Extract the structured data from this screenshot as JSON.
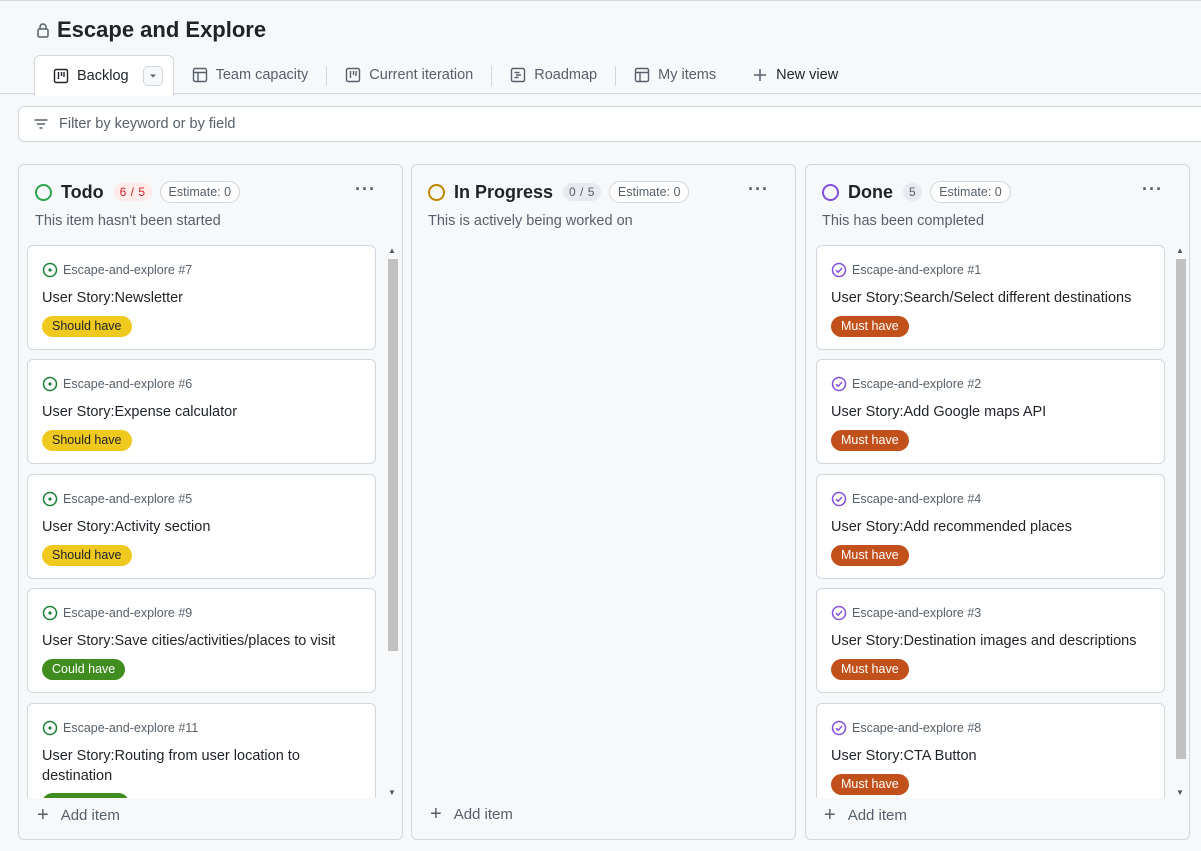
{
  "project": {
    "title": "Escape and Explore"
  },
  "tabs": [
    {
      "label": "Backlog",
      "icon": "board-icon"
    },
    {
      "label": "Team capacity",
      "icon": "table-icon"
    },
    {
      "label": "Current iteration",
      "icon": "board-icon"
    },
    {
      "label": "Roadmap",
      "icon": "roadmap-icon"
    },
    {
      "label": "My items",
      "icon": "table-icon"
    },
    {
      "label": "New view",
      "icon": "plus-icon"
    }
  ],
  "filter": {
    "placeholder": "Filter by keyword or by field"
  },
  "columns": [
    {
      "name": "Todo",
      "count": "6 / 5",
      "estimate": "Estimate: 0",
      "description": "This item hasn't been started",
      "status_color": "#2da44e",
      "add_label": "Add item",
      "cards": [
        {
          "ref": "Escape-and-explore #7",
          "title": "User Story:Newsletter",
          "label": "Should have"
        },
        {
          "ref": "Escape-and-explore #6",
          "title": "User Story:Expense calculator",
          "label": "Should have"
        },
        {
          "ref": "Escape-and-explore #5",
          "title": "User Story:Activity section",
          "label": "Should have"
        },
        {
          "ref": "Escape-and-explore #9",
          "title": "User Story:Save cities/activities/places to visit",
          "label": "Could have"
        },
        {
          "ref": "Escape-and-explore #11",
          "title": "User Story:Routing from user location to destination",
          "label": ""
        }
      ]
    },
    {
      "name": "In Progress",
      "count": "0 / 5",
      "estimate": "Estimate: 0",
      "description": "This is actively being worked on",
      "status_color": "#bf8700",
      "add_label": "Add item",
      "cards": []
    },
    {
      "name": "Done",
      "count": "5",
      "estimate": "Estimate: 0",
      "description": "This has been completed",
      "status_color": "#8250df",
      "add_label": "Add item",
      "cards": [
        {
          "ref": "Escape-and-explore #1",
          "title": "User Story:Search/Select different destinations",
          "label": "Must have"
        },
        {
          "ref": "Escape-and-explore #2",
          "title": "User Story:Add Google maps API",
          "label": "Must have"
        },
        {
          "ref": "Escape-and-explore #4",
          "title": "User Story:Add recommended places",
          "label": "Must have"
        },
        {
          "ref": "Escape-and-explore #3",
          "title": "User Story:Destination images and descriptions",
          "label": "Must have"
        },
        {
          "ref": "Escape-and-explore #8",
          "title": "User Story:CTA Button",
          "label": "Must have"
        }
      ]
    }
  ]
}
